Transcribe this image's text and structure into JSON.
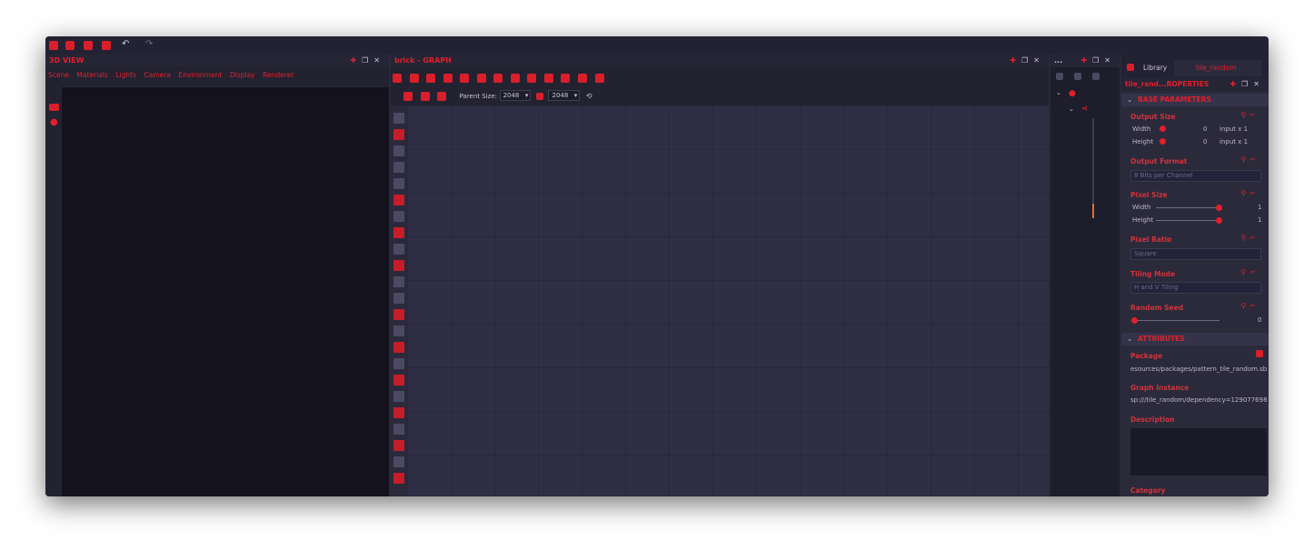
{
  "topbar": {
    "icons": [
      "new-icon",
      "open-icon",
      "folder-icon",
      "save-icon",
      "undo-icon",
      "redo-icon"
    ]
  },
  "view3d": {
    "title": "3D VIEW",
    "menu": [
      "Scene",
      "Materials",
      "Lights",
      "Camera",
      "Environment",
      "Display",
      "Renderer"
    ],
    "side_icons": [
      "camera-icon",
      "light-icon"
    ]
  },
  "graph": {
    "title": "brick - GRAPH",
    "parent_size_label": "Parent Size:",
    "size_w": "2048",
    "size_h": "2048"
  },
  "outliner": {
    "title": "..."
  },
  "properties": {
    "tab_library": "Library",
    "tab_instance": "tile_random",
    "title": "tile_rand...ROPERTIES",
    "section_base": "BASE PARAMETERS",
    "output_size": {
      "label": "Output Size",
      "width_label": "Width",
      "height_label": "Height",
      "width_value": "0",
      "height_value": "0",
      "width_suffix": "input x 1",
      "height_suffix": "input x 1"
    },
    "output_format": {
      "label": "Output Format",
      "value": "8 Bits per Channel"
    },
    "pixel_size": {
      "label": "Pixel Size",
      "width_label": "Width",
      "height_label": "Height",
      "width_value": "1",
      "height_value": "1"
    },
    "pixel_ratio": {
      "label": "Pixel Ratio",
      "value": "Square"
    },
    "tiling_mode": {
      "label": "Tiling Mode",
      "value": "H and V Tiling"
    },
    "random_seed": {
      "label": "Random Seed",
      "value": "0"
    },
    "section_attributes": "ATTRIBUTES",
    "package": {
      "label": "Package",
      "value": "esources/packages/pattern_tile_random.sb"
    },
    "graph_instance": {
      "label": "Graph Instance",
      "value": "sp:///tile_random/dependency=129077698"
    },
    "description": {
      "label": "Description"
    },
    "category": {
      "label": "Category"
    }
  }
}
